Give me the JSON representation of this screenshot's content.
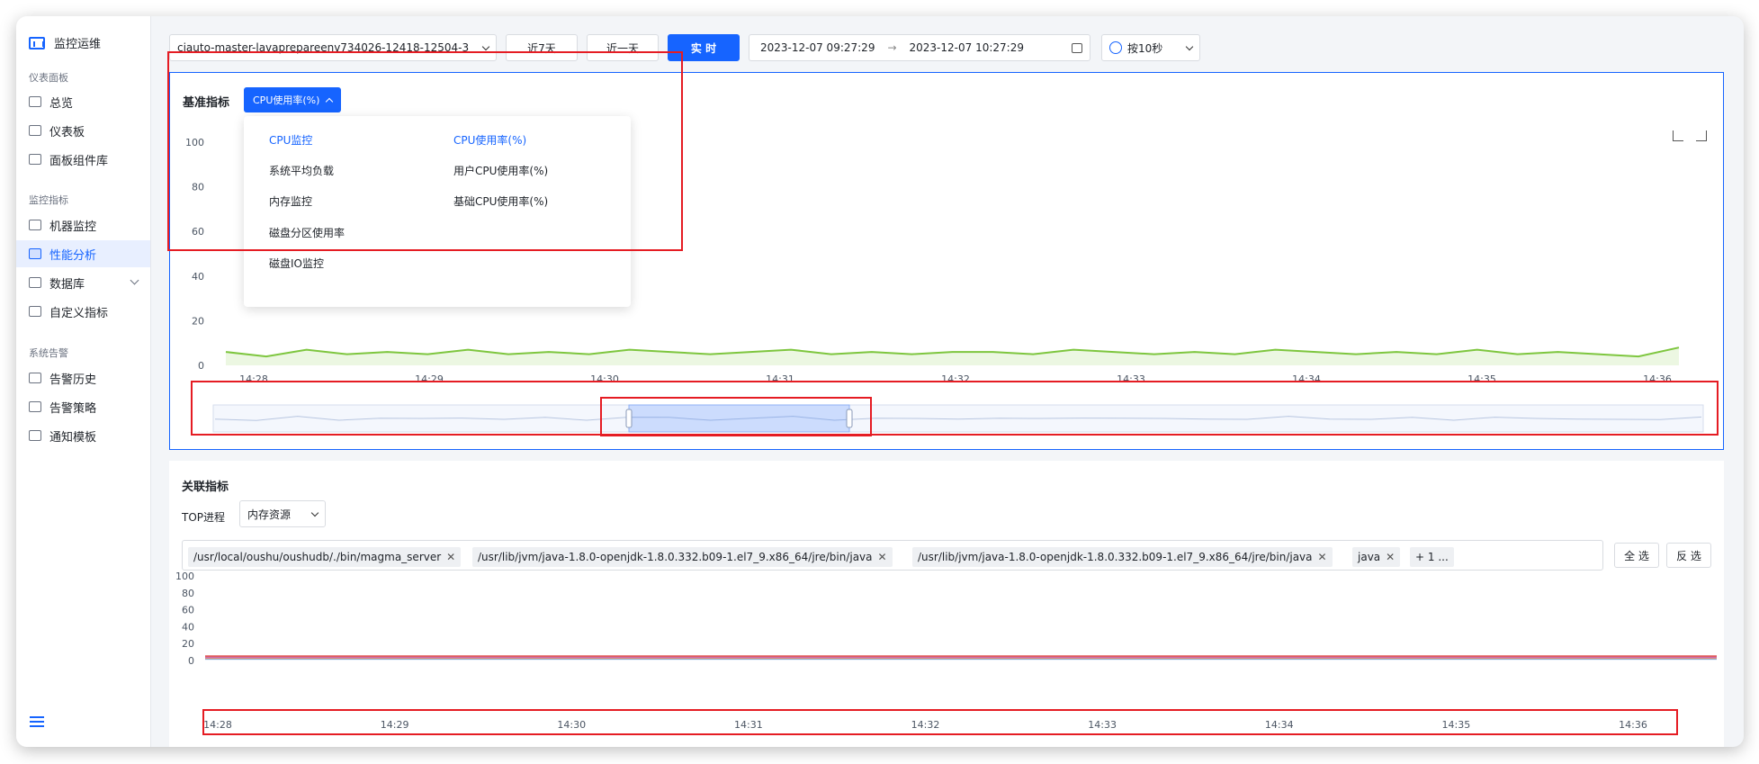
{
  "sidebar": {
    "brand": "监控运维",
    "sections": [
      "仪表面板",
      "监控指标",
      "系统告警"
    ],
    "items": [
      {
        "label": "总览",
        "icon": "home-icon"
      },
      {
        "label": "仪表板",
        "icon": "dashboard-icon"
      },
      {
        "label": "面板组件库",
        "icon": "widget-library-icon"
      },
      {
        "label": "机器监控",
        "icon": "machine-monitor-icon"
      },
      {
        "label": "性能分析",
        "icon": "performance-icon",
        "active": true
      },
      {
        "label": "数据库",
        "icon": "database-icon"
      },
      {
        "label": "自定义指标",
        "icon": "custom-metric-icon"
      },
      {
        "label": "告警历史",
        "icon": "alert-history-icon"
      },
      {
        "label": "告警策略",
        "icon": "alert-policy-icon"
      },
      {
        "label": "通知模板",
        "icon": "notification-icon"
      }
    ]
  },
  "toolbar": {
    "host_select": "ciauto-master-lavaprepareenv734026-12418-12504-3",
    "btn_7d": "近7天",
    "btn_1d": "近一天",
    "btn_realtime": "实 时",
    "range_start": "2023-12-07 09:27:29",
    "range_arrow": "→",
    "range_end": "2023-12-07 10:27:29",
    "interval": "按10秒"
  },
  "base_panel": {
    "title": "基准指标",
    "dropdown_label": "CPU使用率(%)",
    "menu_left": [
      "CPU监控",
      "系统平均负载",
      "内存监控",
      "磁盘分区使用率",
      "磁盘IO监控"
    ],
    "menu_right": [
      "CPU使用率(%)",
      "用户CPU使用率(%)",
      "基础CPU使用率(%)"
    ],
    "accent": "#1664ff",
    "line_color": "#7ec63f"
  },
  "assoc_panel": {
    "title": "关联指标",
    "top_label": "TOP进程",
    "resource_select": "内存资源",
    "tags": [
      "/usr/local/oushu/oushudb/./bin/magma_server",
      "/usr/lib/jvm/java-1.8.0-openjdk-1.8.0.332.b09-1.el7_9.x86_64/jre/bin/java",
      "/usr/lib/jvm/java-1.8.0-openjdk-1.8.0.332.b09-1.el7_9.x86_64/jre/bin/java",
      "java"
    ],
    "more_tag": "+ 1 ...",
    "select_all": "全 选",
    "invert": "反 选"
  },
  "chart_data": [
    {
      "type": "area",
      "x": [
        "14:28",
        "14:29",
        "14:30",
        "14:31",
        "14:32",
        "14:33",
        "14:34",
        "14:35",
        "14:36"
      ],
      "ylim": [
        0,
        100
      ],
      "yticks": [
        0,
        20,
        40,
        60,
        80,
        100
      ],
      "series": [
        {
          "values": [
            6,
            4,
            7,
            5,
            6,
            5,
            7,
            5,
            6,
            5,
            7,
            6,
            5,
            6,
            7,
            5,
            6,
            5,
            6,
            6,
            5,
            7,
            6,
            5,
            6,
            5,
            7,
            6,
            5,
            6,
            5,
            7,
            5,
            6,
            5,
            4,
            8
          ],
          "color": "#7ec63f"
        }
      ]
    },
    {
      "type": "line",
      "x": [
        "14:28",
        "14:29",
        "14:30",
        "14:31",
        "14:32",
        "14:33",
        "14:34",
        "14:35",
        "14:36"
      ],
      "ylim": [
        0,
        100
      ],
      "yticks": [
        0,
        20,
        40,
        60,
        80,
        100
      ],
      "series": [
        {
          "values": [
            2,
            2,
            2,
            2,
            2,
            2,
            2,
            2,
            2
          ],
          "color": "#6aa8f0"
        },
        {
          "values": [
            3,
            3,
            3,
            3,
            3,
            3,
            3,
            3,
            3
          ],
          "color": "#f0a05a"
        },
        {
          "values": [
            4,
            4,
            4,
            4,
            4,
            4,
            4,
            4,
            4
          ],
          "color": "#c06bd0"
        },
        {
          "values": [
            5,
            5,
            5,
            5,
            5,
            5,
            5,
            5,
            5
          ],
          "color": "#e05b5b"
        }
      ]
    }
  ]
}
